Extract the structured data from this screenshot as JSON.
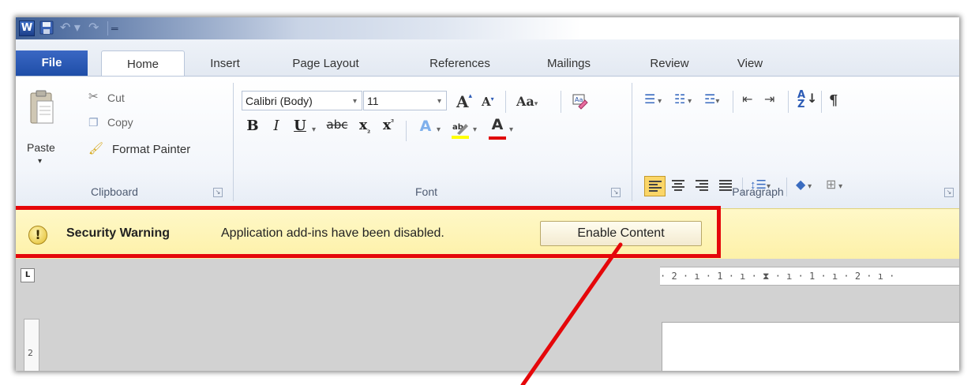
{
  "tabs": {
    "file": "File",
    "home": "Home",
    "insert": "Insert",
    "page_layout": "Page Layout",
    "references": "References",
    "mailings": "Mailings",
    "review": "Review",
    "view": "View"
  },
  "qat": {
    "app_icon_letter": "W"
  },
  "clipboard": {
    "paste": "Paste",
    "cut": "Cut",
    "copy": "Copy",
    "format_painter": "Format Painter",
    "label": "Clipboard"
  },
  "font": {
    "name": "Calibri (Body)",
    "size": "11",
    "label": "Font"
  },
  "paragraph": {
    "label": "Paragraph"
  },
  "message_bar": {
    "title": "Security Warning",
    "text": "Application add-ins have been disabled.",
    "button": "Enable Content"
  },
  "ruler": {
    "tab_selector": "L",
    "h_marks": "· 2 · ı · 1 · ı · ⧗ · ı · 1 · ı · 2 · ı ·",
    "v_mark": "2"
  },
  "colors": {
    "file_tab": "#2b5bb8",
    "message_bar": "#fdf3b4",
    "highlight_box": "#e5070a",
    "highlight_yellow": "#ffff00",
    "font_red": "#e00000"
  }
}
